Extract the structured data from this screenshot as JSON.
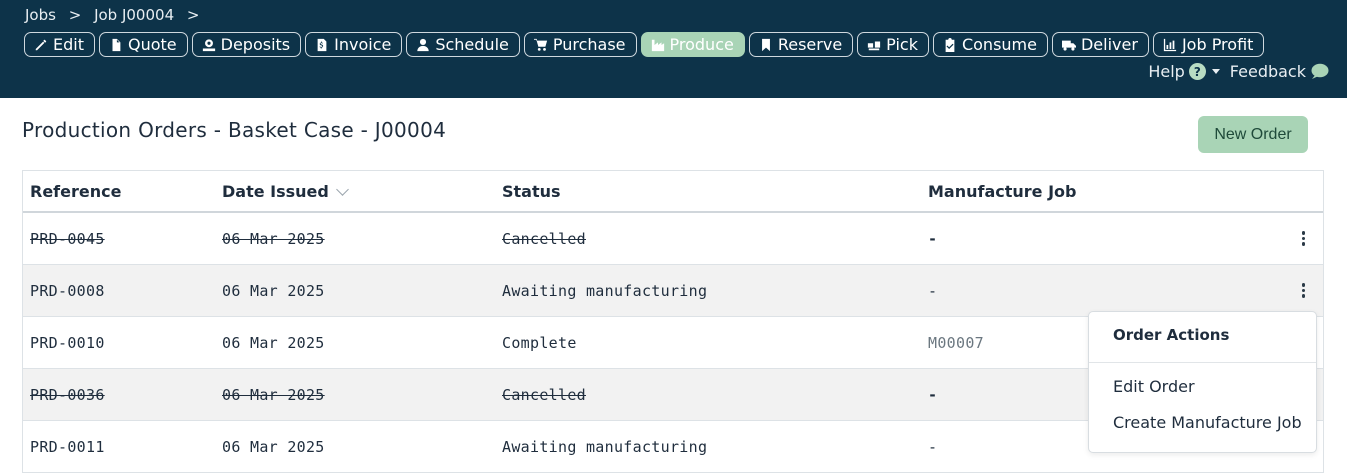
{
  "breadcrumb": [
    {
      "label": "Jobs"
    },
    {
      "label": ">"
    },
    {
      "label": "Job J00004"
    },
    {
      "label": ">"
    }
  ],
  "tabs": [
    {
      "label": "Edit",
      "icon": "pencil-icon"
    },
    {
      "label": "Quote",
      "icon": "document-icon"
    },
    {
      "label": "Deposits",
      "icon": "deposit-icon"
    },
    {
      "label": "Invoice",
      "icon": "invoice-icon"
    },
    {
      "label": "Schedule",
      "icon": "user-icon"
    },
    {
      "label": "Purchase",
      "icon": "cart-icon"
    },
    {
      "label": "Produce",
      "icon": "factory-icon",
      "active": true
    },
    {
      "label": "Reserve",
      "icon": "bookmark-icon"
    },
    {
      "label": "Pick",
      "icon": "pick-icon"
    },
    {
      "label": "Consume",
      "icon": "clipboard-icon"
    },
    {
      "label": "Deliver",
      "icon": "truck-icon"
    },
    {
      "label": "Job Profit",
      "icon": "bar-chart-icon"
    }
  ],
  "help": {
    "label": "Help",
    "symbol": "?"
  },
  "feedback": {
    "label": "Feedback"
  },
  "page": {
    "title": "Production Orders - Basket Case - J00004",
    "new_order": "New Order"
  },
  "table": {
    "columns": [
      "Reference",
      "Date Issued",
      "Status",
      "Manufacture Job"
    ],
    "rows": [
      {
        "reference": "PRD-0045",
        "date": "06 Mar 2025",
        "status": "Cancelled",
        "job": "-",
        "cancelled": true
      },
      {
        "reference": "PRD-0008",
        "date": "06 Mar 2025",
        "status": "Awaiting manufacturing",
        "job": "-",
        "cancelled": false
      },
      {
        "reference": "PRD-0010",
        "date": "06 Mar 2025",
        "status": "Complete",
        "job": "M00007",
        "cancelled": false
      },
      {
        "reference": "PRD-0036",
        "date": "06 Mar 2025",
        "status": "Cancelled",
        "job": "-",
        "cancelled": true
      },
      {
        "reference": "PRD-0011",
        "date": "06 Mar 2025",
        "status": "Awaiting manufacturing",
        "job": "-",
        "cancelled": false
      }
    ]
  },
  "order_actions": {
    "title": "Order Actions",
    "items": [
      "Edit Order",
      "Create Manufacture Job"
    ]
  },
  "colors": {
    "header_bg": "#0d3349",
    "accent_green": "#a9d4b6"
  }
}
